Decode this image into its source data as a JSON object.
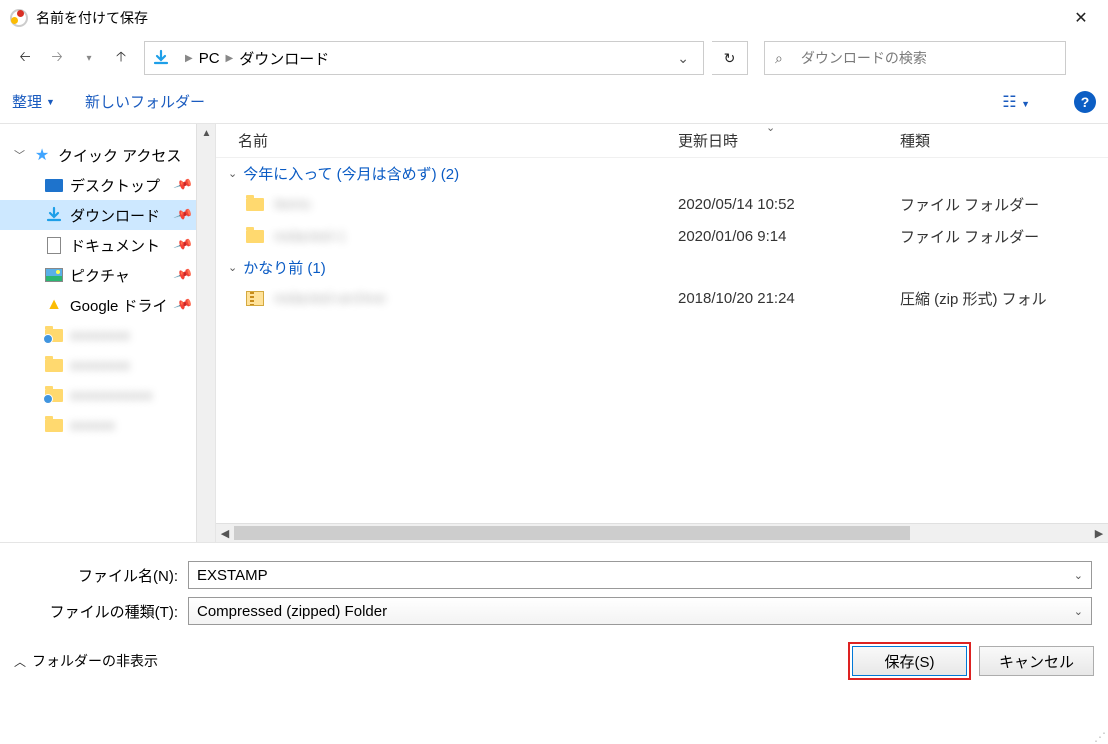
{
  "titlebar": {
    "title": "名前を付けて保存"
  },
  "nav": {
    "path_crumbs": [
      "PC",
      "ダウンロード"
    ],
    "search_placeholder": "ダウンロードの検索"
  },
  "toolbar": {
    "organize": "整理",
    "newfolder": "新しいフォルダー"
  },
  "tree": {
    "quick_access": "クイック アクセス",
    "items": [
      {
        "label": "デスクトップ",
        "pin": true,
        "icon": "desktop"
      },
      {
        "label": "ダウンロード",
        "pin": true,
        "icon": "download",
        "selected": true
      },
      {
        "label": "ドキュメント",
        "pin": true,
        "icon": "doc"
      },
      {
        "label": "ピクチャ",
        "pin": true,
        "icon": "pic"
      },
      {
        "label": "Google ドライ",
        "pin": true,
        "icon": "gdrive"
      }
    ]
  },
  "columns": {
    "name": "名前",
    "date": "更新日時",
    "type": "種類"
  },
  "groups": [
    {
      "label": "今年に入って (今月は含めず) (2)",
      "files": [
        {
          "name": "Items",
          "date": "2020/05/14 10:52",
          "type": "ファイル フォルダー",
          "icon": "folder"
        },
        {
          "name": "redacted-1",
          "date": "2020/01/06 9:14",
          "type": "ファイル フォルダー",
          "icon": "folder"
        }
      ]
    },
    {
      "label": "かなり前 (1)",
      "files": [
        {
          "name": "redacted-archive",
          "date": "2018/10/20 21:24",
          "type": "圧縮 (zip 形式) フォル",
          "icon": "zip"
        }
      ]
    }
  ],
  "form": {
    "filename_label": "ファイル名(N):",
    "filename_value": "EXSTAMP",
    "filetype_label": "ファイルの種類(T):",
    "filetype_value": "Compressed (zipped) Folder"
  },
  "bottom": {
    "hide_folders": "フォルダーの非表示",
    "save": "保存(S)",
    "cancel": "キャンセル"
  }
}
